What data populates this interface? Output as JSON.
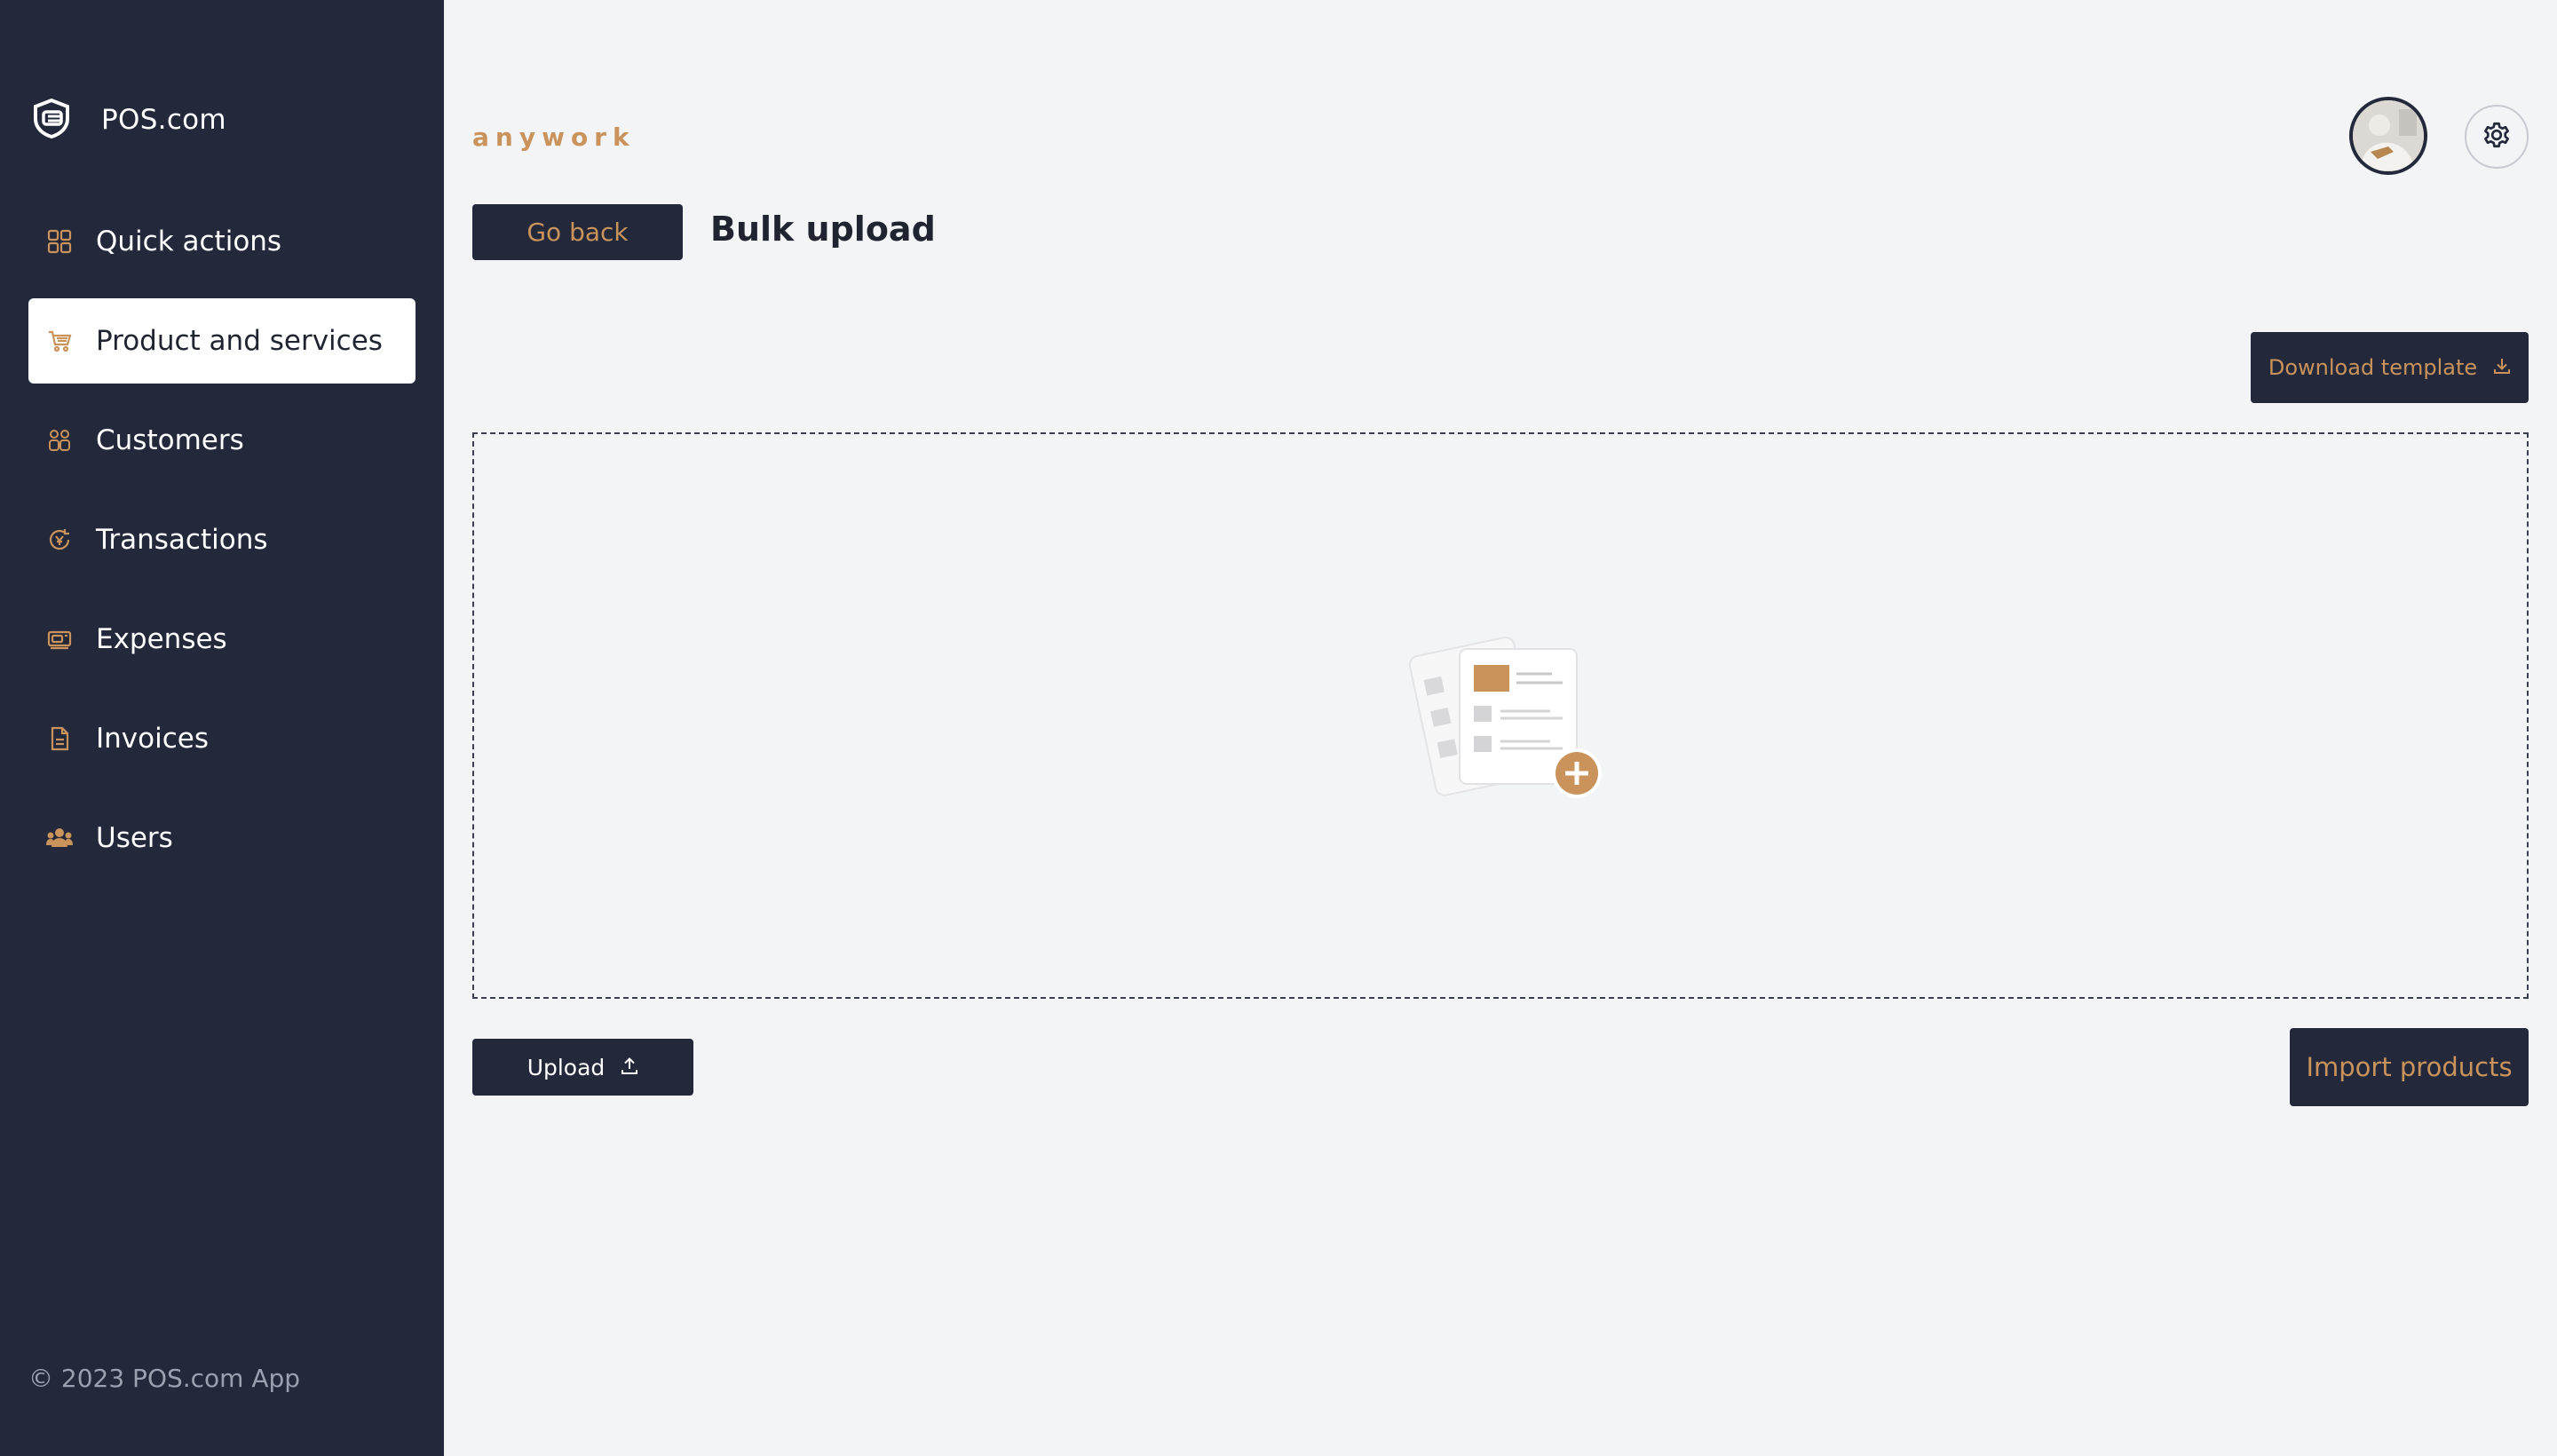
{
  "brand": {
    "name": "POS.com",
    "logo_icon": "pos-logo-icon"
  },
  "sidebar": {
    "items": [
      {
        "label": "Quick actions",
        "icon": "grid-icon",
        "active": false
      },
      {
        "label": "Product and services",
        "icon": "cart-icon",
        "active": true
      },
      {
        "label": "Customers",
        "icon": "customers-icon",
        "active": false
      },
      {
        "label": "Transactions",
        "icon": "transactions-icon",
        "active": false
      },
      {
        "label": "Expenses",
        "icon": "expenses-icon",
        "active": false
      },
      {
        "label": "Invoices",
        "icon": "invoice-icon",
        "active": false
      },
      {
        "label": "Users",
        "icon": "users-icon",
        "active": false
      }
    ],
    "copyright": "© 2023 POS.com App"
  },
  "header": {
    "workspace": "anywork",
    "settings_icon": "gear-icon"
  },
  "page": {
    "go_back_label": "Go back",
    "title": "Bulk upload",
    "download_label": "Download template",
    "upload_label": "Upload",
    "import_label": "Import products"
  },
  "colors": {
    "sidebar_bg": "#23283a",
    "accent": "#c9935b",
    "page_bg": "#f3f4f6"
  }
}
